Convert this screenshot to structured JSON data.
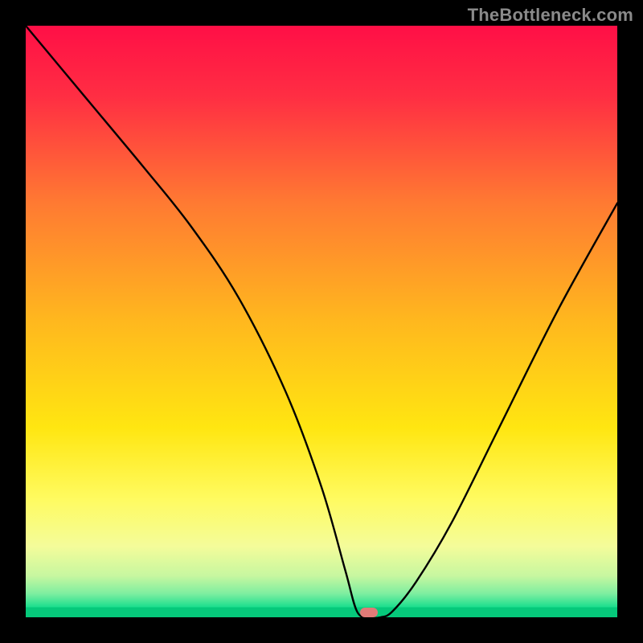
{
  "watermark": "TheBottleneck.com",
  "marker": {
    "x_pct": 58,
    "y_pct": 99.2
  },
  "chart_data": {
    "type": "line",
    "title": "",
    "xlabel": "",
    "ylabel": "",
    "xlim": [
      0,
      100
    ],
    "ylim": [
      0,
      100
    ],
    "series": [
      {
        "name": "bottleneck-curve",
        "x": [
          0,
          10,
          20,
          28,
          36,
          44,
          50,
          54,
          56,
          58,
          60,
          62,
          66,
          72,
          80,
          90,
          100
        ],
        "y": [
          100,
          88,
          76,
          66,
          54,
          38,
          22,
          8,
          1,
          0,
          0,
          1,
          6,
          16,
          32,
          52,
          70
        ]
      }
    ],
    "background_gradient": {
      "stops": [
        {
          "pct": 0,
          "color": "#ff0f46"
        },
        {
          "pct": 12,
          "color": "#ff2e43"
        },
        {
          "pct": 30,
          "color": "#ff7a32"
        },
        {
          "pct": 50,
          "color": "#ffb81e"
        },
        {
          "pct": 68,
          "color": "#ffe611"
        },
        {
          "pct": 80,
          "color": "#fffb60"
        },
        {
          "pct": 88,
          "color": "#f4fc9a"
        },
        {
          "pct": 93,
          "color": "#c7f7a0"
        },
        {
          "pct": 96,
          "color": "#7eeea0"
        },
        {
          "pct": 98.2,
          "color": "#1fdf8f"
        },
        {
          "pct": 98.4,
          "color": "#06c97b"
        },
        {
          "pct": 100,
          "color": "#06c97b"
        }
      ]
    },
    "marker_point": {
      "x": 58,
      "y": 0
    }
  }
}
